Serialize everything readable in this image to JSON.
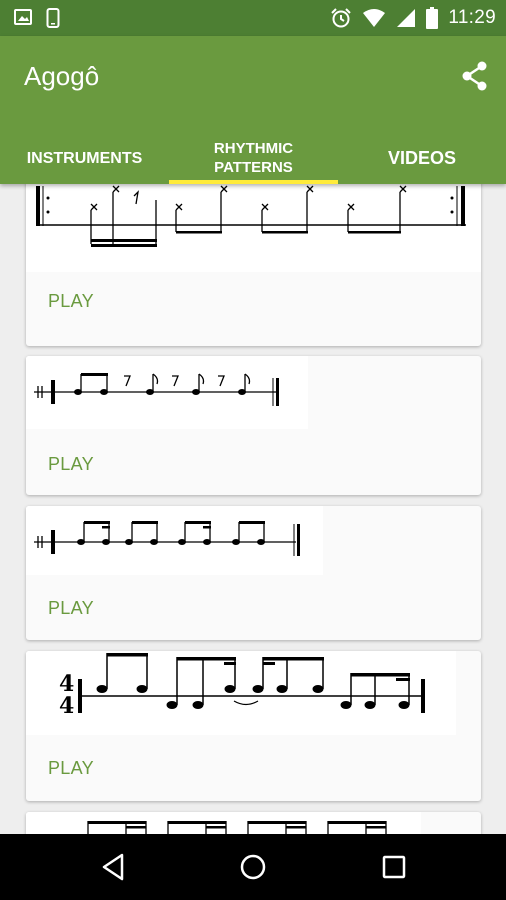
{
  "status_bar": {
    "time": "11:29"
  },
  "app": {
    "title": "Agogô"
  },
  "tabs": [
    {
      "line1": "INSTRUMENTS",
      "line2": ""
    },
    {
      "line1": "RHYTHMIC",
      "line2": "PATTERNS"
    },
    {
      "line1": "VIDEOS",
      "line2": ""
    }
  ],
  "selected_tab": "RHYTHMIC PATTERNS",
  "patterns": [
    {
      "play_label": "PLAY"
    },
    {
      "play_label": "PLAY"
    },
    {
      "play_label": "PLAY"
    },
    {
      "play_label": "PLAY",
      "time_signature": "4/4"
    },
    {
      "play_label": ""
    }
  ],
  "colors": {
    "status_bar": "#4d7f33",
    "app_bar": "#6a9a3f",
    "tab_indicator": "#ffeb3b",
    "accent": "#6a9a3f"
  }
}
